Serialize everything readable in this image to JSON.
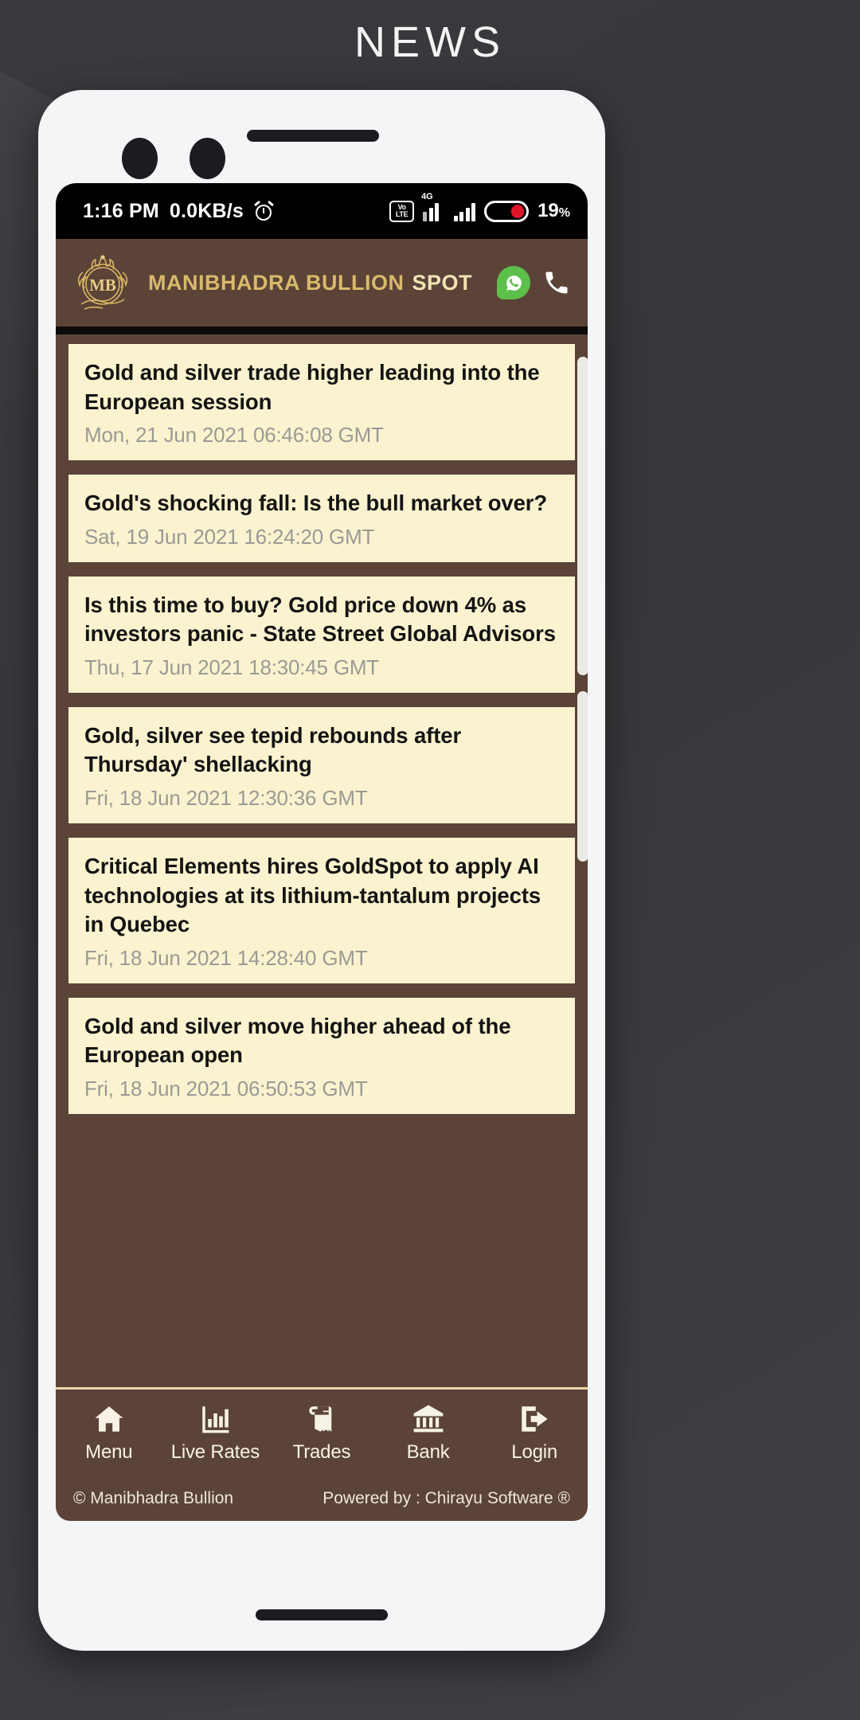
{
  "poster": {
    "title": "NEWS"
  },
  "status_bar": {
    "time": "1:16 PM",
    "network_speed": "0.0KB/s",
    "alarm_icon": "alarm-clock-icon",
    "volte_line1": "Vo",
    "volte_line2": "LTE",
    "network_type": "4G",
    "battery_percent": "19",
    "battery_unit": "%",
    "battery_color": "#e0152a"
  },
  "app_bar": {
    "logo_monogram": "MB",
    "brand_primary": "MANIBHADRA BULLION",
    "brand_secondary": "SPOT",
    "whatsapp_icon": "whatsapp-icon",
    "phone_icon": "phone-icon",
    "brand_primary_color": "#d9b96b",
    "brand_secondary_color": "#f2e3b5",
    "background_color": "#5b4338"
  },
  "news": {
    "card_background": "#fbf3cf",
    "items": [
      {
        "title": "Gold and silver trade higher leading into the European session",
        "date": "Mon, 21 Jun 2021 06:46:08 GMT"
      },
      {
        "title": "Gold's shocking fall: Is the bull market over?",
        "date": "Sat, 19 Jun 2021 16:24:20 GMT"
      },
      {
        "title": "Is this time to buy? Gold price down 4% as investors panic - State Street Global Advisors",
        "date": "Thu, 17 Jun 2021 18:30:45 GMT"
      },
      {
        "title": "Gold, silver see tepid rebounds after Thursday' shellacking",
        "date": "Fri, 18 Jun 2021 12:30:36 GMT"
      },
      {
        "title": "Critical Elements hires GoldSpot to apply AI technologies at its lithium-tantalum projects in Quebec",
        "date": "Fri, 18 Jun 2021 14:28:40 GMT"
      },
      {
        "title": "Gold and silver move higher ahead of the European open",
        "date": "Fri, 18 Jun 2021 06:50:53 GMT"
      }
    ]
  },
  "bottom_nav": {
    "items": [
      {
        "label": "Menu",
        "icon": "home-icon"
      },
      {
        "label": "Live Rates",
        "icon": "bar-chart-icon"
      },
      {
        "label": "Trades",
        "icon": "book-icon"
      },
      {
        "label": "Bank",
        "icon": "bank-icon"
      },
      {
        "label": "Login",
        "icon": "logout-arrow-icon"
      }
    ]
  },
  "footer": {
    "copyright": "© Manibhadra Bullion",
    "powered_by": "Powered by : Chirayu Software ®"
  }
}
